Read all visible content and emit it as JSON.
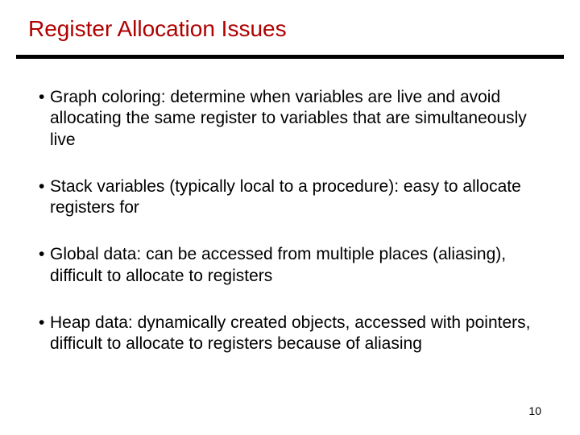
{
  "title": "Register Allocation Issues",
  "bullets": [
    "Graph coloring: determine when variables are live and avoid allocating the same register to variables that are simultaneously live",
    "Stack variables (typically local to a procedure): easy to allocate registers for",
    "Global data: can be accessed from multiple places (aliasing), difficult to allocate to registers",
    "Heap data: dynamically created objects, accessed with pointers, difficult to allocate to registers because of aliasing"
  ],
  "page_number": "10",
  "bullet_marker": "•"
}
